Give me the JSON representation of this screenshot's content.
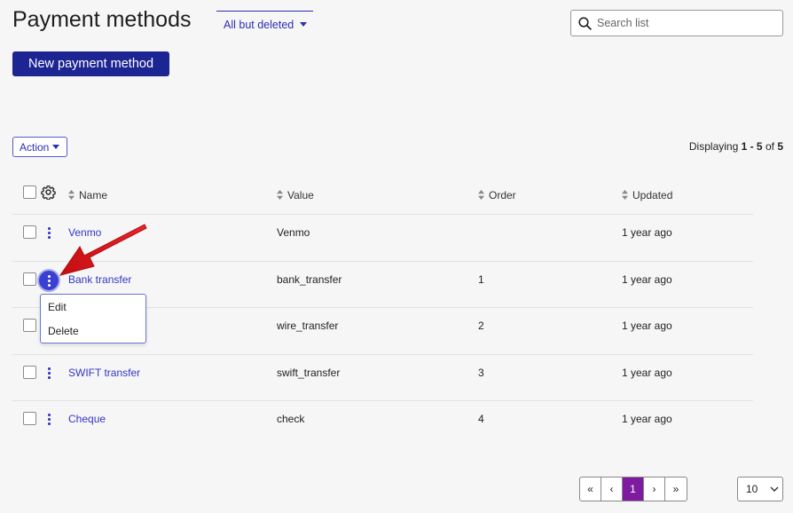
{
  "header": {
    "title": "Payment methods",
    "filter_label": "All but deleted",
    "search_placeholder": "Search list",
    "new_button_label": "New payment method"
  },
  "toolbar": {
    "action_label": "Action",
    "displaying_prefix": "Displaying",
    "displaying_range": "1 - 5",
    "displaying_of": "of",
    "displaying_total": "5"
  },
  "table": {
    "columns": [
      "Name",
      "Value",
      "Order",
      "Updated"
    ],
    "rows": [
      {
        "name": "Venmo",
        "value": "Venmo",
        "order": "",
        "updated": "1 year ago"
      },
      {
        "name": "Bank transfer",
        "value": "bank_transfer",
        "order": "1",
        "updated": "1 year ago"
      },
      {
        "name": "",
        "value": "wire_transfer",
        "order": "2",
        "updated": "1 year ago"
      },
      {
        "name": "SWIFT transfer",
        "value": "swift_transfer",
        "order": "3",
        "updated": "1 year ago"
      },
      {
        "name": "Cheque",
        "value": "check",
        "order": "4",
        "updated": "1 year ago"
      }
    ]
  },
  "row_menu": {
    "items": [
      "Edit",
      "Delete"
    ]
  },
  "pagination": {
    "first": "«",
    "prev": "‹",
    "current": "1",
    "next": "›",
    "last": "»",
    "per_page": "10"
  },
  "colors": {
    "primary": "#1d2592",
    "link": "#3337c4",
    "active_page": "#7e1ba0",
    "annotation_arrow": "#d9161c"
  },
  "icons": {
    "search": "search-icon",
    "settings": "gear-icon",
    "sort": "sort-icon",
    "row_actions": "kebab-icon",
    "dropdown": "chevron-down-icon",
    "annotation": "red-arrow-icon"
  }
}
